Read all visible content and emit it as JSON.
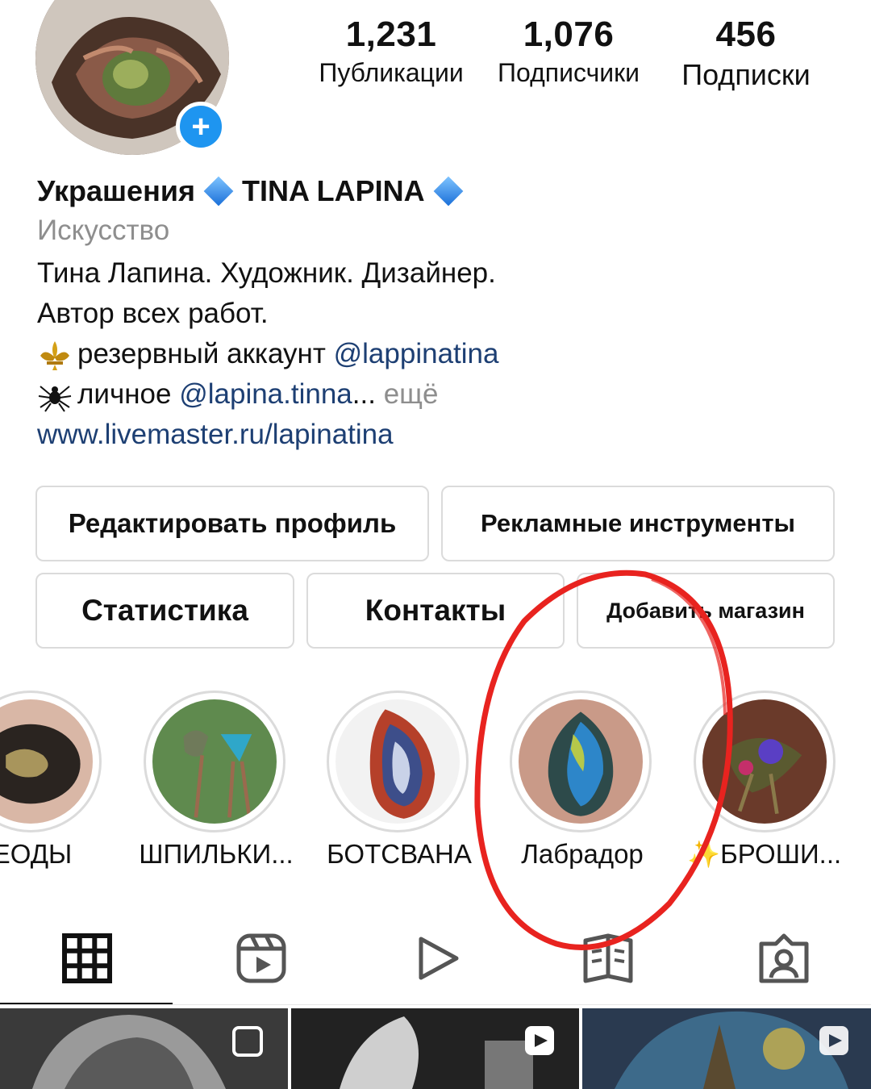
{
  "profile": {
    "stats": [
      {
        "value": "1,231",
        "label": "Публикации"
      },
      {
        "value": "1,076",
        "label": "Подписчики"
      },
      {
        "value": "456",
        "label": "Подписки"
      }
    ],
    "name_part1": "Украшения",
    "name_part2": "TINA LAPINA",
    "category": "Искусство",
    "bio_line1": "Тина Лапина. Художник. Дизайнер.",
    "bio_line2": "Автор всех работ.",
    "bio_line3_text": "резервный аккаунт ",
    "bio_line3_link": "@lappinatina",
    "bio_line4_text": "личное ",
    "bio_line4_link": "@lapina.tinna",
    "bio_line4_ellipsis": "...",
    "bio_more": " ещё",
    "website": "www.livemaster.ru/lapinatina"
  },
  "buttons": {
    "edit_profile": "Редактировать профиль",
    "ad_tools": "Рекламные инструменты",
    "insights": "Статистика",
    "contacts": "Контакты",
    "add_shop": "Добавить магазин"
  },
  "highlights": [
    {
      "label": "ЕОДЫ"
    },
    {
      "label": "ШПИЛЬКИ..."
    },
    {
      "label": "БОТСВАНА"
    },
    {
      "label": "Лабрадор"
    },
    {
      "label": "БРОШИ..."
    }
  ],
  "tabs": [
    {
      "icon": "grid-icon"
    },
    {
      "icon": "reels-icon"
    },
    {
      "icon": "video-play-icon"
    },
    {
      "icon": "guides-icon"
    },
    {
      "icon": "tagged-icon"
    }
  ],
  "colors": {
    "accent_blue": "#1e95f0",
    "link_blue": "#1d3f73",
    "annotation_red": "#e8231f",
    "border": "#dbdbdb"
  }
}
